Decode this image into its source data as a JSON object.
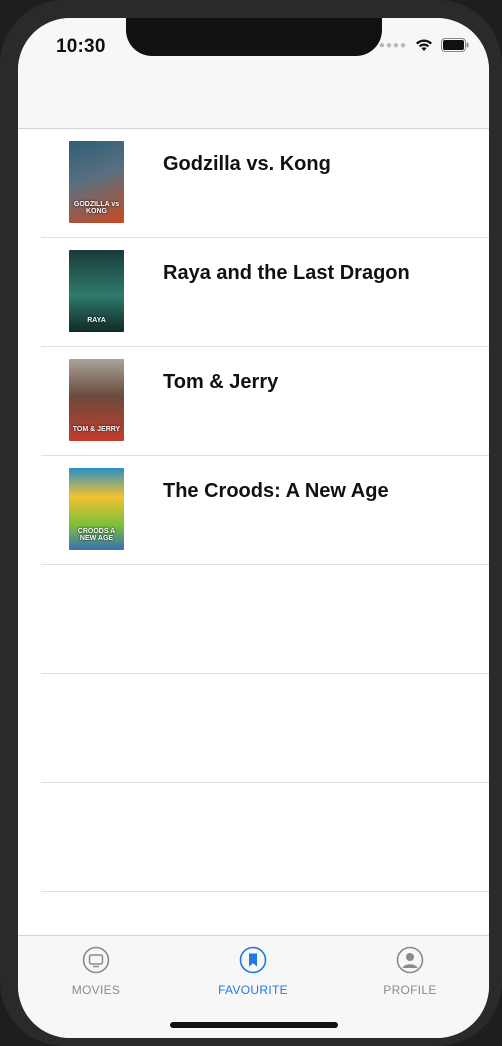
{
  "status": {
    "time": "10:30"
  },
  "movies": [
    {
      "title": "Godzilla vs. Kong",
      "poster_text": "GODZILLA vs KONG",
      "colors": [
        "#2d5e7a",
        "#c84a23"
      ]
    },
    {
      "title": "Raya and the Last Dragon",
      "poster_text": "RAYA",
      "colors": [
        "#1f5a55",
        "#2f7b6b"
      ]
    },
    {
      "title": "Tom & Jerry",
      "poster_text": "TOM & JERRY",
      "colors": [
        "#6b4a3d",
        "#c43d2c"
      ]
    },
    {
      "title": "The Croods: A New Age",
      "poster_text": "CROODS A NEW AGE",
      "colors": [
        "#2a8ec7",
        "#7bbf3a"
      ]
    }
  ],
  "tabbar": {
    "items": [
      {
        "label": "MOVIES",
        "icon": "tv-icon",
        "active": false
      },
      {
        "label": "FAVOURITE",
        "icon": "bookmark-icon",
        "active": true
      },
      {
        "label": "PROFILE",
        "icon": "person-icon",
        "active": false
      }
    ]
  },
  "colors": {
    "accent": "#1f7ae0",
    "inactive": "#8a8a8e"
  }
}
